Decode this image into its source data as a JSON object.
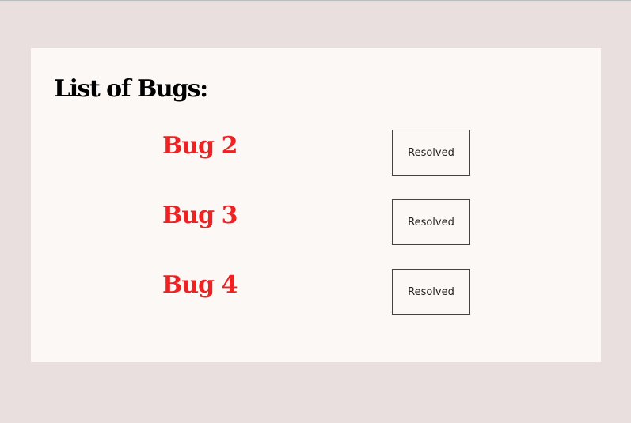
{
  "page": {
    "heading": "List of Bugs:"
  },
  "bugs": [
    {
      "name": "Bug 2",
      "action_label": "Resolved"
    },
    {
      "name": "Bug 3",
      "action_label": "Resolved"
    },
    {
      "name": "Bug 4",
      "action_label": "Resolved"
    }
  ],
  "colors": {
    "page_background": "#e8dfde",
    "card_background": "#fcf8f5",
    "bug_name": "#ee2222",
    "heading": "#000000"
  }
}
